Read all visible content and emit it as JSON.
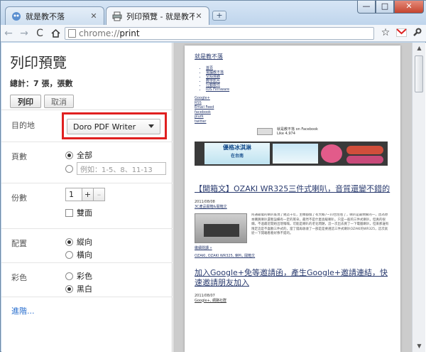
{
  "browser": {
    "tabs": [
      {
        "label": "就是教不落",
        "active": false
      },
      {
        "label": "列印預覽 - 就是教不落",
        "active": true
      }
    ],
    "new_tab_label": "+",
    "window_buttons": {
      "minimize": "—",
      "maximize": "□",
      "close": "✕"
    },
    "address": {
      "scheme": "chrome://",
      "path": "print"
    }
  },
  "sidebar": {
    "title": "列印預覽",
    "total": "總計：7 張，張數",
    "print_button": "列印",
    "cancel_button": "取消",
    "destination": {
      "label": "目的地",
      "selected": "Doro PDF Writer"
    },
    "pages": {
      "label": "頁數",
      "all": "全部",
      "placeholder": "例如：1-5、8、11-13"
    },
    "copies": {
      "label": "份數",
      "value": "1",
      "plus": "+",
      "minus": "–",
      "duplex": "雙面"
    },
    "layout": {
      "label": "配置",
      "portrait": "縱向",
      "landscape": "橫向"
    },
    "color": {
      "label": "彩色",
      "color": "彩色",
      "bw": "黑白"
    },
    "more": "進階..."
  },
  "preview": {
    "blog_title": "就是教不落",
    "nav_items": [
      "首頁",
      "電腦教不落",
      "空殼燒錄",
      "教學影片",
      "行動軟件",
      "IOS Firmware"
    ],
    "small_links": [
      "Google+",
      "RSS",
      "Email Feed",
      "facebook",
      "plurk",
      "twitter"
    ],
    "fb_text": "就是教不落 on Facebook",
    "fb_like": "Like  4,974",
    "banner_text": "優格冰淇淋",
    "banner_sub": "在台南",
    "post1_title": "【開箱文】OZAKI WR325三件式喇叭，音質還變不錯的",
    "post1_date": "2011/08/08",
    "post1_links": "3C產品開箱&開箱文",
    "post1_text": "阿通最電的喇叭既現了幾這十年，主機都換了有大概7~10台左右了，喇叭是最頻繁的一，因為原本購買喇叭還暫設備有一定的耳朵，最然不是什麼高級喇叭，只是一般的三件式喇叭，但真的很爛，不過最近開始出現嗡嗡，可能是喇叭的老化問題，這一次出去買了一下電腦喇叭，但來那邊有限定這是不喜歡三件式的，當了錢再收收了一部是是要選這三件式喇叭OZAKI的WR325，這次就從一下開箱看看好像不錯的。",
    "post1_foot": "繼續閱讀 »",
    "post1_tags": "OZAKI, OZAKI WR325, 喇叭, 開箱文",
    "post2_title": "加入Google+免等邀請函，產生Google+邀請連結，快速邀請朋友加入",
    "post2_date": "2011/08/07",
    "post2_links": "Google+, 網路社群"
  }
}
